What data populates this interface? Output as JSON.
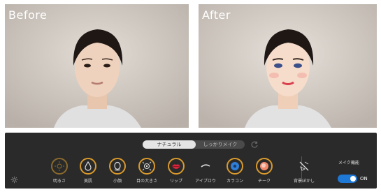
{
  "preview": {
    "before_label": "Before",
    "after_label": "After"
  },
  "mode_toggle": {
    "natural_label": "ナチュラル",
    "custom_label": "しっかりメイク"
  },
  "tools": [
    {
      "label": "明るさ",
      "icon": "brightness-icon"
    },
    {
      "label": "美肌",
      "icon": "droplet-icon"
    },
    {
      "label": "小顔",
      "icon": "face-outline-icon"
    },
    {
      "label": "目の大きさ",
      "icon": "eye-size-icon"
    },
    {
      "label": "リップ",
      "icon": "lips-icon"
    },
    {
      "label": "アイブロウ",
      "icon": "eyebrow-icon"
    },
    {
      "label": "カラコン",
      "icon": "color-contact-icon"
    },
    {
      "label": "チーク",
      "icon": "blush-icon"
    },
    {
      "label": "背景ぼかし",
      "icon": "background-blur-icon"
    }
  ],
  "makeup_function": {
    "label": "メイク機能",
    "state": "ON"
  },
  "colors": {
    "bar_background": "#2a2a2a",
    "ring_accent": "#d99a2b",
    "switch_on": "#1e78d6"
  }
}
